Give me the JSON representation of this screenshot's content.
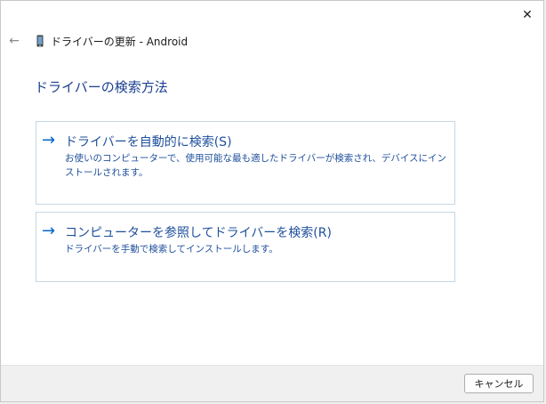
{
  "window": {
    "title": "ドライバーの更新 - Android",
    "close_glyph": "✕",
    "back_glyph": "←",
    "icons": {
      "close": "close-icon",
      "back": "back-arrow-icon",
      "device": "android-phone-icon"
    }
  },
  "main": {
    "heading": "ドライバーの検索方法",
    "options": [
      {
        "arrow_glyph": "→",
        "title": "ドライバーを自動的に検索(S)",
        "description": "お使いのコンピューターで、使用可能な最も適したドライバーが検索され、デバイスにインストールされます。"
      },
      {
        "arrow_glyph": "→",
        "title": "コンピューターを参照してドライバーを検索(R)",
        "description": "ドライバーを手動で検索してインストールします。"
      }
    ]
  },
  "footer": {
    "cancel_label": "キャンセル"
  },
  "colors": {
    "accent": "#0066cc",
    "link_text": "#1e4f9c",
    "heading": "#1b3f8f",
    "option_border": "#c5d7e4"
  }
}
